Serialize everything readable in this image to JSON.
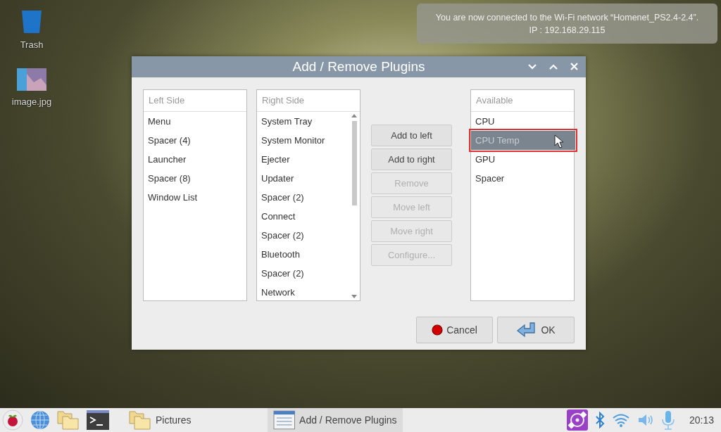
{
  "desktop_icons": [
    {
      "kind": "trash",
      "label": "Trash"
    },
    {
      "kind": "image",
      "label": "image.jpg"
    }
  ],
  "notification": {
    "lines": [
      "You are now connected to the Wi-Fi network “Homenet_PS2.4-2.4”.",
      "IP : 192.168.29.115"
    ]
  },
  "dialog": {
    "title": "Add / Remove Plugins",
    "left_side": {
      "header": "Left Side",
      "items": [
        {
          "label": "Menu",
          "selected": false
        },
        {
          "label": "Spacer (4)",
          "selected": false
        },
        {
          "label": "Launcher",
          "selected": false
        },
        {
          "label": "Spacer (8)",
          "selected": false
        },
        {
          "label": "Window List",
          "selected": false
        }
      ]
    },
    "right_side": {
      "header": "Right Side",
      "items": [
        {
          "label": "System Tray",
          "selected": false
        },
        {
          "label": "System Monitor",
          "selected": false
        },
        {
          "label": "Ejecter",
          "selected": false
        },
        {
          "label": "Updater",
          "selected": false
        },
        {
          "label": "Spacer (2)",
          "selected": false
        },
        {
          "label": "Connect",
          "selected": false
        },
        {
          "label": "Spacer (2)",
          "selected": false
        },
        {
          "label": "Bluetooth",
          "selected": false
        },
        {
          "label": "Spacer (2)",
          "selected": false
        },
        {
          "label": "Network",
          "selected": false
        }
      ]
    },
    "actions": [
      {
        "label": "Add to left",
        "disabled": false
      },
      {
        "label": "Add to right",
        "disabled": false
      },
      {
        "label": "Remove",
        "disabled": true
      },
      {
        "label": "Move left",
        "disabled": true
      },
      {
        "label": "Move right",
        "disabled": true
      },
      {
        "label": "Configure...",
        "disabled": true
      }
    ],
    "available": {
      "header": "Available",
      "items": [
        {
          "label": "CPU",
          "selected": false
        },
        {
          "label": "CPU Temp",
          "selected": true
        },
        {
          "label": "GPU",
          "selected": false
        },
        {
          "label": "Spacer",
          "selected": false
        }
      ]
    },
    "buttons": [
      {
        "kind": "cancel",
        "label": "Cancel"
      },
      {
        "kind": "ok",
        "label": "OK"
      }
    ]
  },
  "taskbar": {
    "windows": [
      {
        "kind": "folder",
        "label": "Pictures",
        "selected": false
      },
      {
        "kind": "plugins",
        "label": "Add / Remove Plugins",
        "selected": true
      }
    ],
    "clock": "20:13"
  }
}
